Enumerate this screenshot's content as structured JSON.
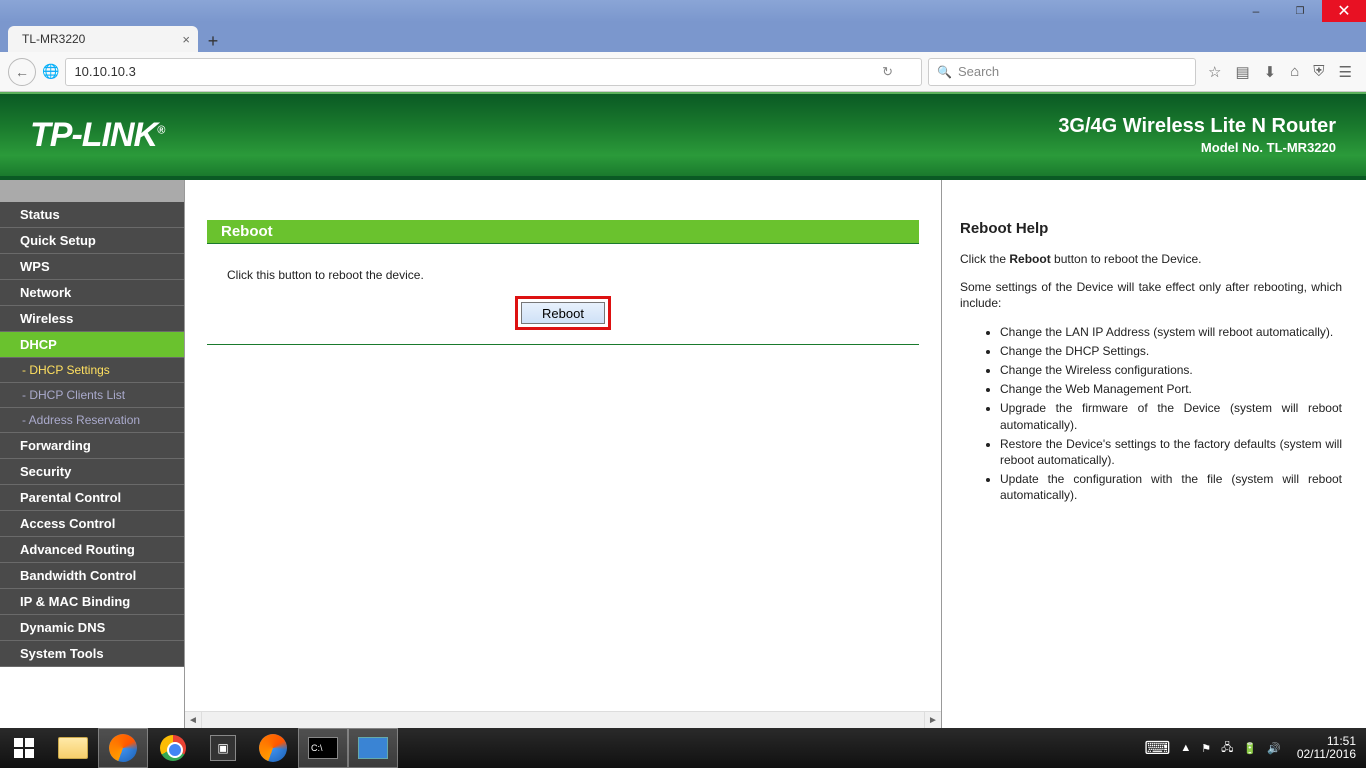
{
  "browser": {
    "tab_title": "TL-MR3220",
    "url": "10.10.10.3",
    "search_placeholder": "Search"
  },
  "header": {
    "brand": "TP-LINK",
    "product": "3G/4G Wireless Lite N Router",
    "model": "Model No. TL-MR3220"
  },
  "sidebar": {
    "items": [
      {
        "label": "Status"
      },
      {
        "label": "Quick Setup"
      },
      {
        "label": "WPS"
      },
      {
        "label": "Network"
      },
      {
        "label": "Wireless"
      },
      {
        "label": "DHCP",
        "active": true,
        "subs": [
          {
            "label": "- DHCP Settings",
            "sel": true
          },
          {
            "label": "- DHCP Clients List"
          },
          {
            "label": "- Address Reservation"
          }
        ]
      },
      {
        "label": "Forwarding"
      },
      {
        "label": "Security"
      },
      {
        "label": "Parental Control"
      },
      {
        "label": "Access Control"
      },
      {
        "label": "Advanced Routing"
      },
      {
        "label": "Bandwidth Control"
      },
      {
        "label": "IP & MAC Binding"
      },
      {
        "label": "Dynamic DNS"
      },
      {
        "label": "System Tools"
      }
    ]
  },
  "content": {
    "title": "Reboot",
    "instruction": "Click this button to reboot the device.",
    "button_label": "Reboot"
  },
  "help": {
    "title": "Reboot Help",
    "intro_pre": "Click the ",
    "intro_bold": "Reboot",
    "intro_post": " button to reboot the Device.",
    "note": "Some settings of the Device will take effect only after rebooting, which include:",
    "items": [
      "Change the LAN IP Address (system will reboot automatically).",
      "Change the DHCP Settings.",
      "Change the Wireless configurations.",
      "Change the Web Management Port.",
      "Upgrade the firmware of the Device (system will reboot automatically).",
      "Restore the Device's settings to the factory defaults (system will reboot automatically).",
      "Update the configuration with the file (system will reboot automatically)."
    ]
  },
  "taskbar": {
    "time": "11:51",
    "date": "02/11/2016"
  }
}
